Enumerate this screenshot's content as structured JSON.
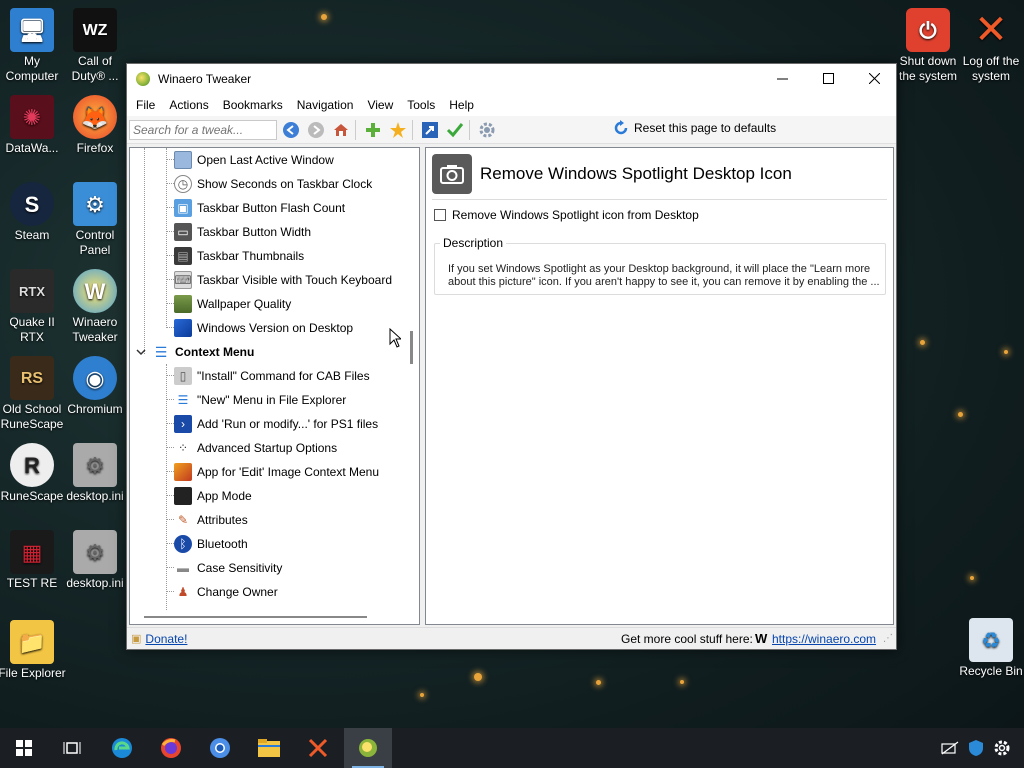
{
  "desktop": {
    "icons": [
      {
        "label": "My Computer",
        "glyph": "🖥"
      },
      {
        "label": "Call of Duty® ...",
        "glyph": "WZ"
      },
      {
        "label": "DataWa...",
        "glyph": "✺"
      },
      {
        "label": "Firefox",
        "glyph": "🦊"
      },
      {
        "label": "Steam",
        "glyph": "S"
      },
      {
        "label": "Control Panel",
        "glyph": "⚙"
      },
      {
        "label": "Quake II RTX",
        "glyph": "RTX"
      },
      {
        "label": "Winaero Tweaker",
        "glyph": "W"
      },
      {
        "label": "Old School RuneScape",
        "glyph": "RS"
      },
      {
        "label": "Chromium",
        "glyph": "◉"
      },
      {
        "label": "RuneScape",
        "glyph": "R"
      },
      {
        "label": "desktop.ini",
        "glyph": "⚙"
      },
      {
        "label": "TEST RE",
        "glyph": "▦"
      },
      {
        "label": "desktop.ini",
        "glyph": "⚙"
      },
      {
        "label": "File Explorer",
        "glyph": "📁"
      },
      {
        "label": "Shut down the system",
        "glyph": "⏻"
      },
      {
        "label": "Log off the system",
        "glyph": "✕"
      },
      {
        "label": "Recycle Bin",
        "glyph": "♻"
      }
    ]
  },
  "window": {
    "title": "Winaero Tweaker",
    "menu": [
      "File",
      "Actions",
      "Bookmarks",
      "Navigation",
      "View",
      "Tools",
      "Help"
    ],
    "search_placeholder": "Search for a tweak...",
    "reset_label": "Reset this page to defaults",
    "tree": {
      "items": [
        "Open Last Active Window",
        "Show Seconds on Taskbar Clock",
        "Taskbar Button Flash Count",
        "Taskbar Button Width",
        "Taskbar Thumbnails",
        "Taskbar Visible with Touch Keyboard",
        "Wallpaper Quality",
        "Windows Version on Desktop"
      ],
      "category": "Context Menu",
      "sub_items": [
        "\"Install\" Command for CAB Files",
        "\"New\" Menu in File Explorer",
        "Add 'Run or modify...' for PS1 files",
        "Advanced Startup Options",
        "App for 'Edit' Image Context Menu",
        "App Mode",
        "Attributes",
        "Bluetooth",
        "Case Sensitivity",
        "Change Owner"
      ]
    },
    "detail": {
      "title": "Remove Windows Spotlight Desktop Icon",
      "option_label": "Remove Windows Spotlight icon from Desktop",
      "description_legend": "Description",
      "description_text": "If you set Windows Spotlight as your Desktop background, it will place the \"Learn more about this picture\" icon. If you aren't happy to see it, you can remove it by enabling the ..."
    },
    "status": {
      "donate": "Donate!",
      "more_text": "Get more cool stuff here:",
      "more_link": "https://winaero.com"
    }
  },
  "taskbar": {
    "apps": [
      "start",
      "task-view",
      "edge",
      "firefox",
      "chromium",
      "file-explorer",
      "close-app",
      "winaero-tweaker"
    ]
  }
}
